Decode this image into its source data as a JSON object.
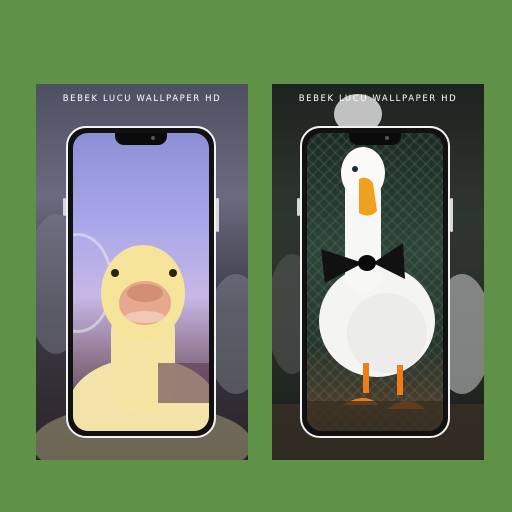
{
  "cards": [
    {
      "title": "BEBEK LUCU WALLPAPER HD",
      "wallpaper": "duckling-selfie"
    },
    {
      "title": "BEBEK LUCU WALLPAPER HD",
      "wallpaper": "white-duck-bowtie"
    }
  ],
  "colors": {
    "background": "#5f9147",
    "phone_frame": "#f2f2f2",
    "title_text": "#ffffff",
    "duck_beak": "#f0a020",
    "bowtie": "#111111"
  }
}
